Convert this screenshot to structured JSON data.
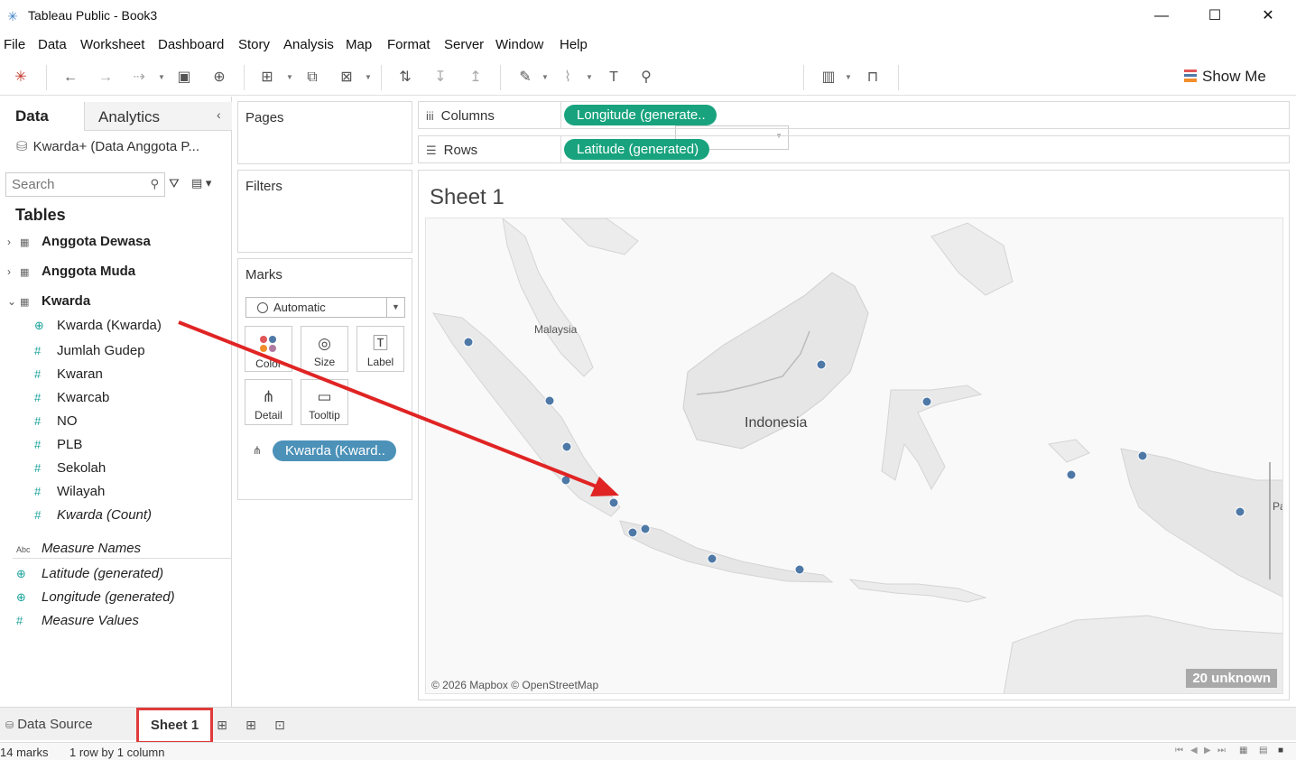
{
  "window": {
    "title": "Tableau Public - Book3",
    "minimize": "—",
    "maximize": "☐",
    "close": "✕"
  },
  "menu": [
    "File",
    "Data",
    "Worksheet",
    "Dashboard",
    "Story",
    "Analysis",
    "Map",
    "Format",
    "Server",
    "Window",
    "Help"
  ],
  "toolbar": {
    "show_me": "Show Me"
  },
  "data_pane": {
    "tab_data": "Data",
    "tab_analytics": "Analytics",
    "datasource": "Kwarda+ (Data Anggota P...",
    "search_placeholder": "Search",
    "tables_header": "Tables",
    "tables": [
      "Anggota Dewasa",
      "Anggota Muda",
      "Kwarda"
    ],
    "kwarda_fields": [
      "Kwarda (Kwarda)",
      "Jumlah Gudep",
      "Kwaran",
      "Kwarcab",
      "NO",
      "PLB",
      "Sekolah",
      "Wilayah",
      "Kwarda (Count)"
    ],
    "measure_fields": [
      "Measure Names",
      "Latitude (generated)",
      "Longitude (generated)",
      "Measure Values"
    ]
  },
  "cards": {
    "pages": "Pages",
    "filters": "Filters",
    "marks": "Marks",
    "marks_type": "Automatic",
    "buttons": [
      "Color",
      "Size",
      "Label",
      "Detail",
      "Tooltip"
    ],
    "detail_pill": "Kwarda (Kward.."
  },
  "shelves": {
    "columns_label": "Columns",
    "columns_pill": "Longitude (generate..",
    "rows_label": "Rows",
    "rows_pill": "Latitude (generated)"
  },
  "viz": {
    "sheet_title": "Sheet 1",
    "label_malaysia": "Malaysia",
    "label_indonesia": "Indonesia",
    "label_pa": "Pa",
    "attribution": "© 2026 Mapbox © OpenStreetMap",
    "unknown_badge": "20 unknown",
    "mark_color": "#4e79a7",
    "annotation_color": "#e02424"
  },
  "sheet_tabs": {
    "data_source": "Data Source",
    "sheet1": "Sheet 1"
  },
  "status": {
    "marks": "14 marks",
    "dims": "1 row by 1 column"
  }
}
